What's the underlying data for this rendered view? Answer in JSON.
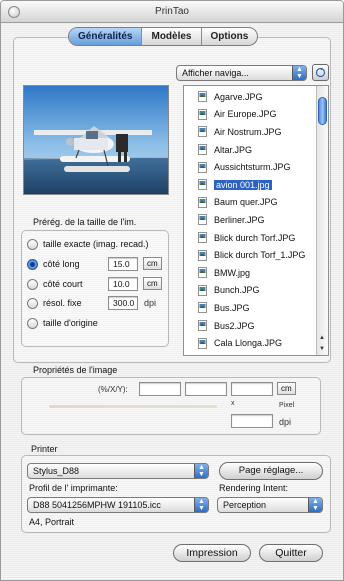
{
  "window": {
    "title": "PrinTao"
  },
  "tabs": [
    {
      "label": "Généralités",
      "active": true
    },
    {
      "label": "Modèles",
      "active": false
    },
    {
      "label": "Options",
      "active": false
    }
  ],
  "browser": {
    "popup_value": "Afficher naviga..."
  },
  "files": [
    {
      "name": "Agarve.JPG",
      "selected": false
    },
    {
      "name": "Air Europe.JPG",
      "selected": false
    },
    {
      "name": "Air Nostrum.JPG",
      "selected": false
    },
    {
      "name": "Altar.JPG",
      "selected": false
    },
    {
      "name": "Aussichtsturm.JPG",
      "selected": false
    },
    {
      "name": "avion 001.jpg",
      "selected": true
    },
    {
      "name": "Baum quer.JPG",
      "selected": false
    },
    {
      "name": "Berliner.JPG",
      "selected": false
    },
    {
      "name": "Blick durch Torf.JPG",
      "selected": false
    },
    {
      "name": "Blick durch Torf_1.JPG",
      "selected": false
    },
    {
      "name": "BMW.jpg",
      "selected": false
    },
    {
      "name": "Bunch.JPG",
      "selected": false
    },
    {
      "name": "Bus.JPG",
      "selected": false
    },
    {
      "name": "Bus2.JPG",
      "selected": false
    },
    {
      "name": "Cala Llonga.JPG",
      "selected": false
    }
  ],
  "sizing": {
    "label": "Prérég. de la taille de l'im.",
    "options": [
      {
        "label": "taille exacte (imag. recad.)",
        "selected": false
      },
      {
        "label": "côté long",
        "selected": true,
        "value": "15.0",
        "unit": "cm"
      },
      {
        "label": "côté court",
        "selected": false,
        "value": "10.0",
        "unit": "cm"
      },
      {
        "label": "résol. fixe",
        "selected": false,
        "value": "300.0",
        "unit": "dpi"
      },
      {
        "label": "taille d'origine",
        "selected": false
      }
    ]
  },
  "properties": {
    "label": "Propriétés de l'image",
    "xy_label": "(%/X/Y):",
    "unit_button": "cm",
    "x_marker": "x",
    "pixel_label": "Pixel",
    "dpi_label": "dpi"
  },
  "printer": {
    "label": "Printer",
    "selected_printer": "Stylus_D88",
    "page_setup_button": "Page réglage...",
    "profile_label": "Profil de l' imprimante:",
    "profile_value": "D88 5041256MPHW 191105.icc",
    "rendering_label": "Rendering Intent:",
    "rendering_value": "Perception",
    "paper_info": "A4, Portrait"
  },
  "actions": {
    "print_label": "Impression",
    "quit_label": "Quitter"
  },
  "colors": {
    "accent": "#3d7ad6",
    "selection": "#2c62c2"
  }
}
